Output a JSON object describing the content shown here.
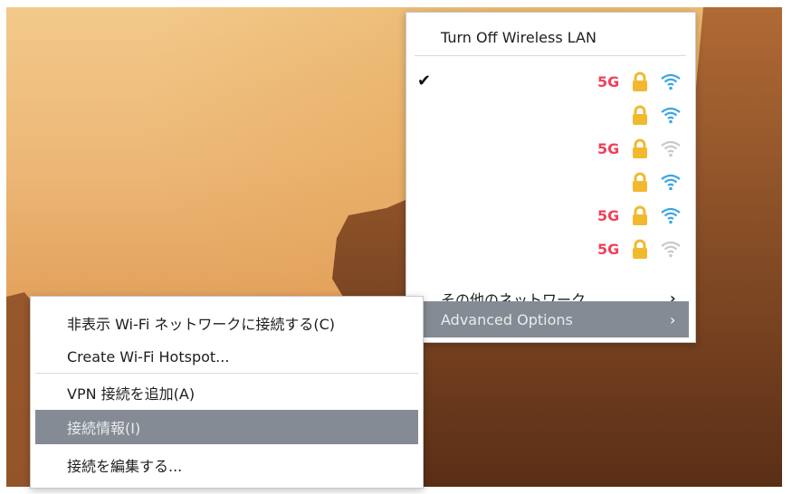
{
  "network_menu": {
    "turn_off_label": "Turn Off Wireless LAN",
    "networks": [
      {
        "connected": true,
        "badge": "5G",
        "secured": true,
        "signal": "strong"
      },
      {
        "connected": false,
        "badge": "",
        "secured": true,
        "signal": "strong"
      },
      {
        "connected": false,
        "badge": "5G",
        "secured": true,
        "signal": "weak"
      },
      {
        "connected": false,
        "badge": "",
        "secured": true,
        "signal": "strong"
      },
      {
        "connected": false,
        "badge": "5G",
        "secured": true,
        "signal": "strong"
      },
      {
        "connected": false,
        "badge": "5G",
        "secured": true,
        "signal": "weak"
      }
    ],
    "check_glyph": "✔",
    "other_networks_label": "その他のネットワーク",
    "advanced_options_label": "Advanced Options",
    "arrow_glyph": "›"
  },
  "advanced_submenu": {
    "items": [
      {
        "label": "非表示  Wi-Fi ネットワークに接続する(C)"
      },
      {
        "label": "Create Wi-Fi Hotspot..."
      },
      {
        "label": "VPN 接続を追加(A)"
      },
      {
        "label": "接続情報(I)",
        "disabled": true
      },
      {
        "label": "接続を編集する..."
      }
    ]
  },
  "colors": {
    "badge_5g": "#f0405a",
    "lock": "#f2b92f",
    "wifi_strong": "#3aa6e3",
    "wifi_weak": "#c9c9c9",
    "highlight": "#858b94"
  }
}
